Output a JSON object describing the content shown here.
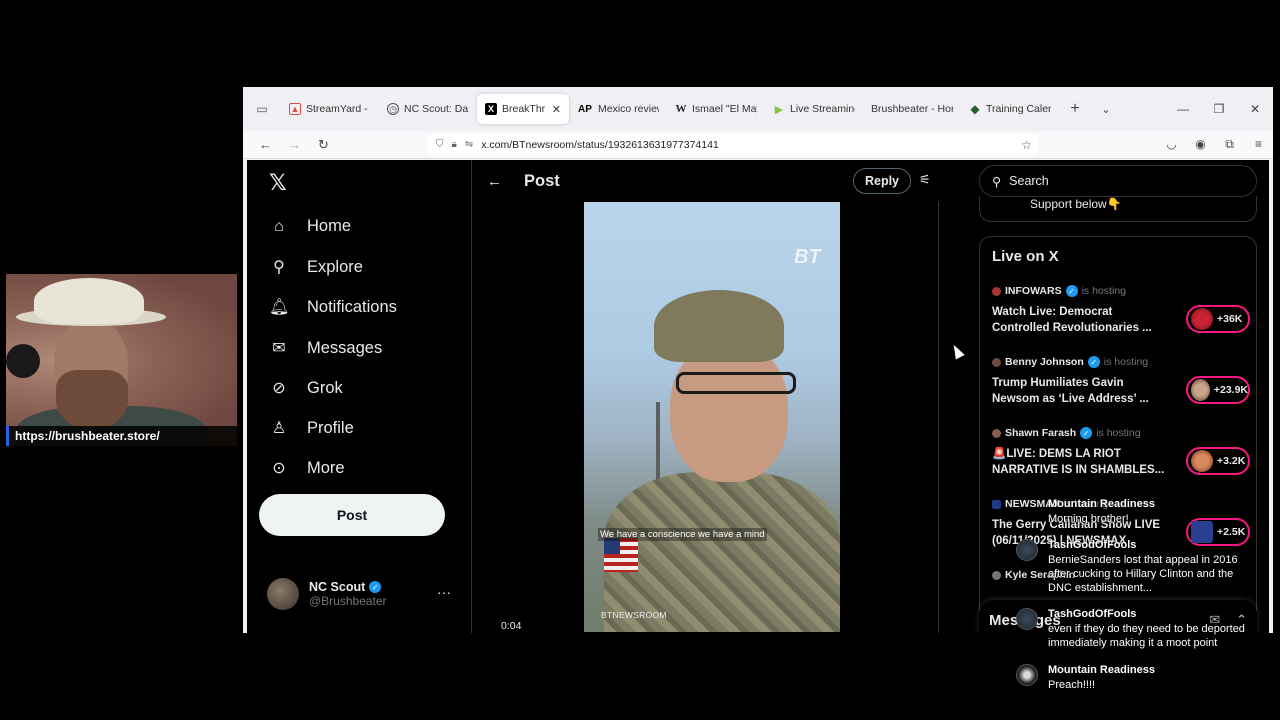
{
  "browser": {
    "tabs": [
      {
        "title": "StreamYard - S",
        "icon": "streamyard-icon",
        "color": "#e24a3b"
      },
      {
        "title": "NC Scout: Dam",
        "icon": "nc-scout-icon",
        "color": "#555555"
      },
      {
        "title": "BreakThroug",
        "icon": "x-logo-icon",
        "color": "#000000",
        "active": true
      },
      {
        "title": "Mexico reviewi",
        "icon": "ap-icon",
        "color": "#c00000"
      },
      {
        "title": "Ismael \"El May",
        "icon": "wikipedia-icon",
        "color": "#333333"
      },
      {
        "title": "Live Streaming",
        "icon": "rumble-icon",
        "color": "#85c742"
      },
      {
        "title": "Brushbeater - Hom",
        "icon": "page-icon",
        "color": "#888888"
      },
      {
        "title": "Training Calenc",
        "icon": "diamond-icon",
        "color": "#2e5e2e"
      }
    ],
    "url": "x.com/BTnewsroom/status/1932613631977374141"
  },
  "x": {
    "nav": {
      "items": [
        {
          "label": "Home",
          "icon": "home-icon"
        },
        {
          "label": "Explore",
          "icon": "search-icon"
        },
        {
          "label": "Notifications",
          "icon": "bell-icon"
        },
        {
          "label": "Messages",
          "icon": "mail-icon"
        },
        {
          "label": "Grok",
          "icon": "grok-icon"
        },
        {
          "label": "Profile",
          "icon": "person-icon"
        },
        {
          "label": "More",
          "icon": "more-circle-icon"
        }
      ],
      "post_button": "Post"
    },
    "account": {
      "name": "NC Scout",
      "handle": "@Brushbeater"
    },
    "main": {
      "title": "Post",
      "reply_button": "Reply",
      "video": {
        "caption": "We have a conscience we have a mind",
        "watermark": "BTNEWSROOM",
        "logo": "BT",
        "time": "0:04"
      }
    },
    "right": {
      "search_placeholder": "Search",
      "support_text": "Support below👇",
      "live_title": "Live on X",
      "live_items": [
        {
          "host": "INFOWARS",
          "status": "is hosting",
          "title1": "Watch Live: Democrat",
          "title2": "Controlled Revolutionaries ...",
          "count": "+36K"
        },
        {
          "host": "Benny Johnson",
          "status": "is hosting",
          "title1": "Trump Humiliates Gavin",
          "title2": "Newsom as ‘Live Address’ ...",
          "count": "+23.9K"
        },
        {
          "host": "Shawn Farash",
          "status": "is hosting",
          "title1": "🚨LIVE: DEMS LA RIOT",
          "title2": "NARRATIVE IS IN SHAMBLES...",
          "count": "+3.2K"
        },
        {
          "host": "NEWSMAX",
          "status": "is hosting",
          "title1": "The Gerry Callahan Show LIVE",
          "title2": "(06/11/2025) | NEWSMAX",
          "count": "+2.5K"
        }
      ],
      "partial_host": "Kyle Seraphin",
      "messages": "Messages"
    }
  },
  "webcam": {
    "link": "https://brushbeater.store/"
  },
  "chat": [
    {
      "name": "Mountain Readiness",
      "text": "Morning brother!"
    },
    {
      "name": "TashGodOfFools",
      "text": "BernieSanders lost that appeal in 2016 after cucking to Hillary Clinton and the DNC establishment..."
    },
    {
      "name": "TashGodOfFools",
      "text": "even if they do they need to be deported immediately making it a moot point"
    },
    {
      "name": "Mountain Readiness",
      "text": "Preach!!!!"
    }
  ]
}
